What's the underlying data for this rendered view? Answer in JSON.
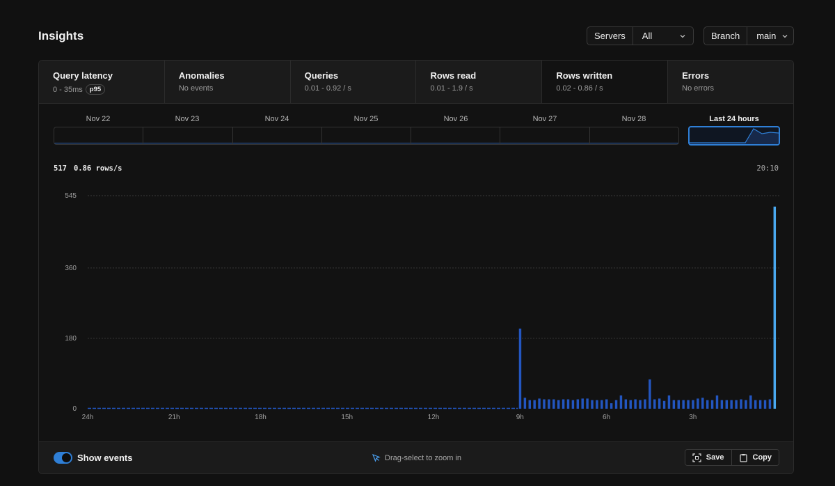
{
  "page": {
    "title": "Insights"
  },
  "filters": {
    "servers_label": "Servers",
    "servers_value": "All",
    "branch_label": "Branch",
    "branch_value": "main"
  },
  "tabs": [
    {
      "name": "Query latency",
      "sub": "0 - 35ms",
      "badge": "p95",
      "active": false
    },
    {
      "name": "Anomalies",
      "sub": "No events",
      "active": false
    },
    {
      "name": "Queries",
      "sub": "0.01 - 0.92 / s",
      "active": false
    },
    {
      "name": "Rows read",
      "sub": "0.01 - 1.9 / s",
      "active": false
    },
    {
      "name": "Rows written",
      "sub": "0.02 - 0.86 / s",
      "active": true
    },
    {
      "name": "Errors",
      "sub": "No errors",
      "active": false
    }
  ],
  "days": {
    "labels": [
      "Nov 22",
      "Nov 23",
      "Nov 24",
      "Nov 25",
      "Nov 26",
      "Nov 27",
      "Nov 28"
    ],
    "last_label": "Last 24 hours"
  },
  "readout": {
    "value": "517",
    "rate": "0.86 rows/s",
    "time": "20:10"
  },
  "footer": {
    "toggle_label": "Show events",
    "hint": "Drag-select to zoom in",
    "save_label": "Save",
    "copy_label": "Copy"
  },
  "colors": {
    "accent": "#2f7fd6",
    "bar": "#2356c0",
    "bar_highlight": "#4aa9f0",
    "grid": "#3a3a3a"
  },
  "chart_data": {
    "type": "bar",
    "ylim": [
      0,
      545
    ],
    "yticks": [
      0,
      180,
      360,
      545
    ],
    "xtick_labels": [
      "24h",
      "21h",
      "18h",
      "15h",
      "12h",
      "9h",
      "6h",
      "3h"
    ],
    "xtick_hours_ago": [
      24,
      21,
      18,
      15,
      12,
      9,
      6,
      3
    ],
    "bucket_minutes": 10,
    "grid": true,
    "legend": "none",
    "bars_last_hours": {
      "hours_ago_start": 9,
      "values": [
        205,
        28,
        22,
        22,
        26,
        24,
        24,
        24,
        22,
        24,
        24,
        22,
        24,
        26,
        26,
        22,
        22,
        22,
        24,
        14,
        22,
        34,
        24,
        22,
        24,
        22,
        24,
        75,
        24,
        26,
        20,
        34,
        22,
        22,
        22,
        22,
        22,
        26,
        28,
        22,
        22,
        34,
        22,
        22,
        22,
        22,
        24,
        22,
        34,
        22,
        22,
        22,
        24,
        517
      ]
    },
    "baseline_value": 1
  }
}
